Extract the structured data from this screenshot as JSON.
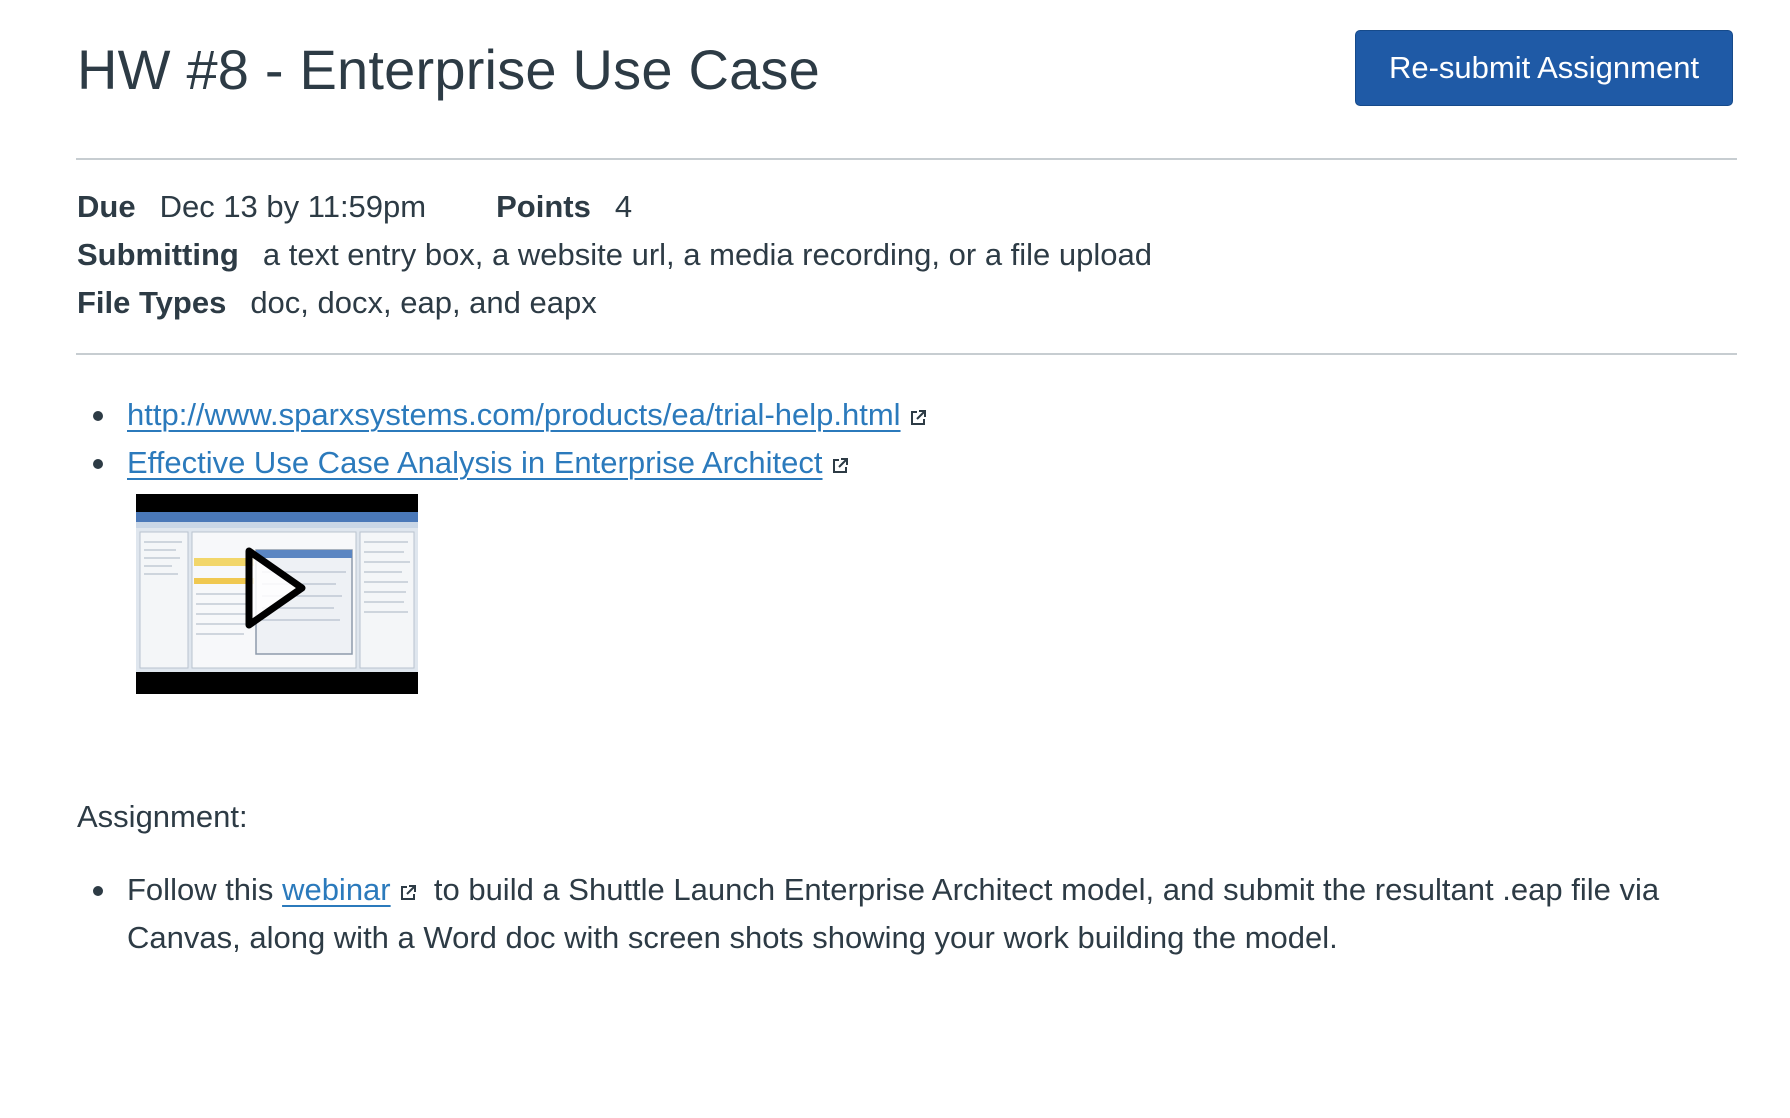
{
  "header": {
    "title": "HW #8 - Enterprise Use Case",
    "resubmit_label": "Re-submit Assignment"
  },
  "details": {
    "due_label": "Due",
    "due_value": "Dec 13 by 11:59pm",
    "points_label": "Points",
    "points_value": "4",
    "submitting_label": "Submitting",
    "submitting_value": "a text entry box, a website url, a media recording, or a file upload",
    "file_types_label": "File Types",
    "file_types_value": "doc, docx, eap, and eapx"
  },
  "resources": {
    "links": [
      {
        "label": "http://www.sparxsystems.com/products/ea/trial-help.html",
        "icon": "external-link-icon"
      },
      {
        "label": "Effective Use Case Analysis in Enterprise Architect",
        "icon": "external-link-icon"
      }
    ],
    "video": {
      "icon": "play-icon"
    }
  },
  "assignment": {
    "label": "Assignment:",
    "task": {
      "prefix": "Follow this",
      "link_label": "webinar",
      "suffix_line1": "to build a Shuttle Launch Enterprise Architect model, and submit the resultant .eap file via",
      "line2": "Canvas, along with a Word doc with screen shots showing your work building the model."
    }
  },
  "colors": {
    "text": "#2d3b45",
    "link": "#2b7abc",
    "button": "#1f5aa6",
    "divider": "#c7cdd1"
  }
}
